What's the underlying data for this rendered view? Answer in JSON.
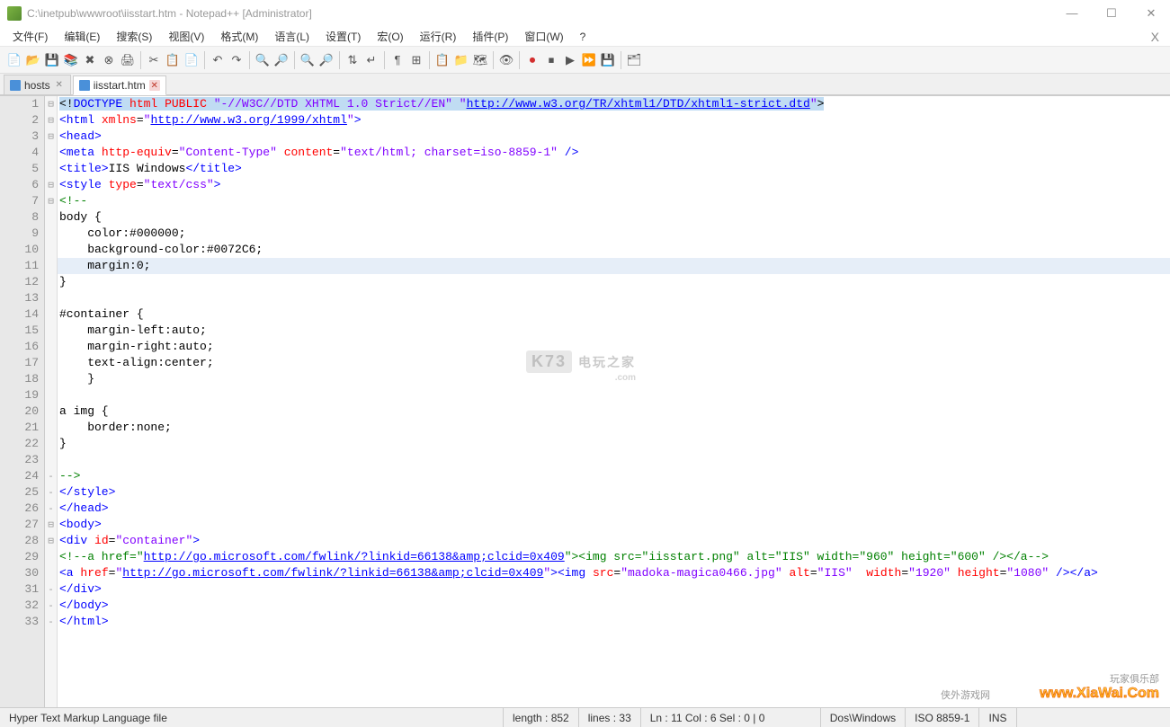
{
  "window": {
    "title": "C:\\inetpub\\wwwroot\\iisstart.htm - Notepad++ [Administrator]"
  },
  "menu": {
    "items": [
      "文件(F)",
      "编辑(E)",
      "搜索(S)",
      "视图(V)",
      "格式(M)",
      "语言(L)",
      "设置(T)",
      "宏(O)",
      "运行(R)",
      "插件(P)",
      "窗口(W)",
      "?"
    ]
  },
  "tabs": {
    "items": [
      {
        "label": "hosts",
        "active": false
      },
      {
        "label": "iisstart.htm",
        "active": true
      }
    ]
  },
  "code": {
    "lines": [
      {
        "n": 1,
        "fold": "⊟",
        "html": "<span class='doctype-hl'>&lt;!<span class='tag'>DOCTYPE</span> <span class='attr'>html</span> <span class='attr'>PUBLIC</span> <span class='aval'>\"-//W3C//DTD XHTML 1.0 Strict//EN\"</span> <span class='aval'>\"</span><span class='link'>http://www.w3.org/TR/xhtml1/DTD/xhtml1-strict.dtd</span><span class='aval'>\"</span>&gt;</span>"
      },
      {
        "n": 2,
        "fold": "⊟",
        "html": "<span class='tag'>&lt;html</span> <span class='attr'>xmlns</span>=<span class='aval'>\"</span><span class='link'>http://www.w3.org/1999/xhtml</span><span class='aval'>\"</span><span class='tag'>&gt;</span>"
      },
      {
        "n": 3,
        "fold": "⊟",
        "html": "<span class='tag'>&lt;head&gt;</span>"
      },
      {
        "n": 4,
        "fold": "",
        "html": "<span class='tag'>&lt;meta</span> <span class='attr'>http-equiv</span>=<span class='aval'>\"Content-Type\"</span> <span class='attr'>content</span>=<span class='aval'>\"text/html; charset=iso-8859-1\"</span> <span class='tag'>/&gt;</span>"
      },
      {
        "n": 5,
        "fold": "",
        "html": "<span class='tag'>&lt;title&gt;</span>IIS Windows<span class='tag'>&lt;/title&gt;</span>"
      },
      {
        "n": 6,
        "fold": "⊟",
        "html": "<span class='tag'>&lt;style</span> <span class='attr'>type</span>=<span class='aval'>\"text/css\"</span><span class='tag'>&gt;</span>"
      },
      {
        "n": 7,
        "fold": "⊟",
        "html": "<span class='comment'>&lt;!--</span>"
      },
      {
        "n": 8,
        "fold": "",
        "html": "body {"
      },
      {
        "n": 9,
        "fold": "",
        "html": "    color:#000000;"
      },
      {
        "n": 10,
        "fold": "",
        "html": "    background-color:#0072C6;"
      },
      {
        "n": 11,
        "fold": "",
        "html": "    margin:0;",
        "current": true
      },
      {
        "n": 12,
        "fold": "",
        "html": "}"
      },
      {
        "n": 13,
        "fold": "",
        "html": ""
      },
      {
        "n": 14,
        "fold": "",
        "html": "#container {"
      },
      {
        "n": 15,
        "fold": "",
        "html": "    margin-left:auto;"
      },
      {
        "n": 16,
        "fold": "",
        "html": "    margin-right:auto;"
      },
      {
        "n": 17,
        "fold": "",
        "html": "    text-align:center;"
      },
      {
        "n": 18,
        "fold": "",
        "html": "    }"
      },
      {
        "n": 19,
        "fold": "",
        "html": ""
      },
      {
        "n": 20,
        "fold": "",
        "html": "a img {"
      },
      {
        "n": 21,
        "fold": "",
        "html": "    border:none;"
      },
      {
        "n": 22,
        "fold": "",
        "html": "}"
      },
      {
        "n": 23,
        "fold": "",
        "html": ""
      },
      {
        "n": 24,
        "fold": "-",
        "html": "<span class='comment'>--&gt;</span>"
      },
      {
        "n": 25,
        "fold": "-",
        "html": "<span class='tag'>&lt;/style&gt;</span>"
      },
      {
        "n": 26,
        "fold": "-",
        "html": "<span class='tag'>&lt;/head&gt;</span>"
      },
      {
        "n": 27,
        "fold": "⊟",
        "html": "<span class='tag'>&lt;body&gt;</span>"
      },
      {
        "n": 28,
        "fold": "⊟",
        "html": "<span class='tag'>&lt;div</span> <span class='attr'>id</span>=<span class='aval'>\"container\"</span><span class='tag'>&gt;</span>"
      },
      {
        "n": 29,
        "fold": "",
        "html": "<span class='comment'>&lt;!--a href=\"</span><span class='link'>http://go.microsoft.com/fwlink/?linkid=66138&amp;amp;clcid=0x409</span><span class='comment'>\"&gt;&lt;img src=\"iisstart.png\" alt=\"IIS\" width=\"960\" height=\"600\" /&gt;&lt;/a--&gt;</span>"
      },
      {
        "n": 30,
        "fold": "",
        "html": "<span class='tag'>&lt;a</span> <span class='attr'>href</span>=<span class='aval'>\"</span><span class='link'>http://go.microsoft.com/fwlink/?linkid=66138&amp;amp;clcid=0x409</span><span class='aval'>\"</span><span class='tag'>&gt;&lt;img</span> <span class='attr'>src</span>=<span class='aval'>\"madoka-magica0466.jpg\"</span> <span class='attr'>alt</span>=<span class='aval'>\"IIS\"</span>  <span class='attr'>width</span>=<span class='aval'>\"1920\"</span> <span class='attr'>height</span>=<span class='aval'>\"1080\"</span> <span class='tag'>/&gt;&lt;/a&gt;</span>"
      },
      {
        "n": 31,
        "fold": "-",
        "html": "<span class='tag'>&lt;/div&gt;</span>"
      },
      {
        "n": 32,
        "fold": "-",
        "html": "<span class='tag'>&lt;/body&gt;</span>"
      },
      {
        "n": 33,
        "fold": "-",
        "html": "<span class='tag'>&lt;/html&gt;</span>"
      }
    ]
  },
  "status": {
    "filetype": "Hyper Text Markup Language file",
    "length": "length : 852",
    "lines": "lines : 33",
    "pos": "Ln : 11    Col : 6    Sel : 0 | 0",
    "eol": "Dos\\Windows",
    "enc": "ISO 8859-1",
    "ins": "INS"
  },
  "watermarks": {
    "center1": "K73",
    "center2": "电玩之家",
    "center3": ".com",
    "bl": "侠外游戏网",
    "br_text": "玩家俱乐部",
    "br_logo": "www.XiaWai.Com"
  },
  "toolbar": {
    "icons": [
      "📄",
      "📂",
      "💾",
      "🗐",
      "✖",
      "🖨",
      "",
      "✂",
      "📋",
      "📄",
      "",
      "↶",
      "↷",
      "",
      "🔍",
      "🔎",
      "🔍",
      "",
      "📑",
      "📑",
      "📑",
      "",
      "👁",
      "",
      "⏺",
      "⏹",
      "▶",
      "⏩",
      "",
      "📄",
      "",
      "🗂"
    ]
  }
}
